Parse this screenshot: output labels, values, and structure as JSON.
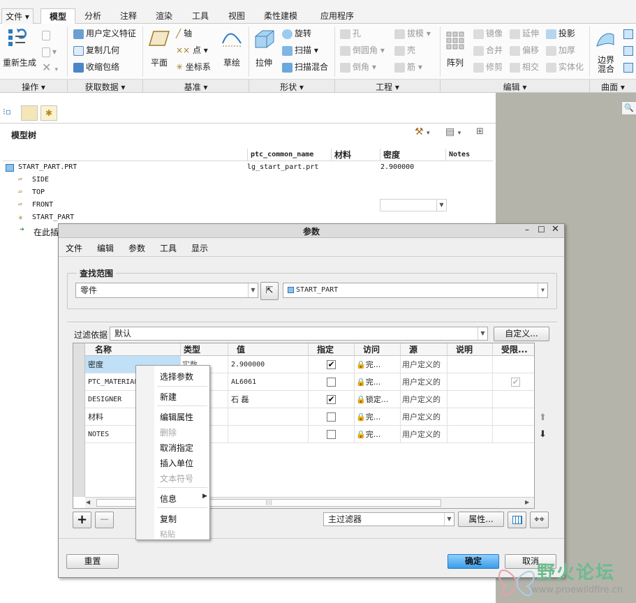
{
  "ribbon_tabs": [
    "文件",
    "模型",
    "分析",
    "注释",
    "渲染",
    "工具",
    "视图",
    "柔性建模",
    "应用程序"
  ],
  "active_tab": "模型",
  "ribbon": {
    "operations": {
      "regenerate": "重新生成"
    },
    "get_data": {
      "user_feature": "用户定义特征",
      "copy_geometry": "复制几何",
      "shrinkwrap": "收缩包络"
    },
    "datum": {
      "plane": "平面",
      "axis": "轴",
      "point": "点",
      "csys": "坐标系",
      "sketch": "草绘"
    },
    "shapes": {
      "extrude": "拉伸",
      "revolve": "旋转",
      "sweep": "扫描",
      "swept_blend": "扫描混合"
    },
    "engineering": {
      "hole": "孔",
      "round": "倒圆角",
      "chamfer": "倒角",
      "draft": "拔模",
      "shell": "壳",
      "rib": "筋"
    },
    "editing": {
      "pattern": "阵列",
      "mirror": "镜像",
      "merge": "合并",
      "trim": "修剪",
      "extend": "延伸",
      "offset": "偏移",
      "intersect": "相交",
      "project": "投影",
      "thicken": "加厚",
      "solidify": "实体化"
    },
    "surfaces": {
      "boundary_blend": "边界混合"
    },
    "group_labels": [
      "操作",
      "获取数据",
      "基准",
      "形状",
      "工程",
      "编辑",
      "曲面"
    ]
  },
  "model_tree": {
    "title": "模型树",
    "columns": [
      "ptc_common_name",
      "材料",
      "密度",
      "Notes"
    ],
    "root": {
      "name": "START_PART.PRT",
      "ptc_common_name": "lg_start_part.prt",
      "density": "2.900000"
    },
    "items": [
      "SIDE",
      "TOP",
      "FRONT",
      "START_PART",
      "在此插"
    ]
  },
  "dialog": {
    "title": "参数",
    "menu": [
      "文件",
      "编辑",
      "参数",
      "工具",
      "显示"
    ],
    "lookin_label": "查找范围",
    "lookin_type": "零件",
    "lookin_object": "START_PART",
    "filter_label": "过滤依据",
    "filter_value": "默认",
    "customize_button": "自定义...",
    "table_headers": [
      "名称",
      "类型",
      "值",
      "指定",
      "访问",
      "源",
      "说明",
      "受限..."
    ],
    "rows": [
      {
        "name": "密度",
        "type": "实数",
        "value": "2.900000",
        "designated": true,
        "access": "完...",
        "source": "用户定义的",
        "restricted": false
      },
      {
        "name": "PTC_MATERIAL",
        "type": "",
        "value": "AL6061",
        "designated": false,
        "access": "完...",
        "source": "用户定义的",
        "restricted": true
      },
      {
        "name": "DESIGNER",
        "type": "",
        "value": "石  磊",
        "designated": true,
        "access": "锁定...",
        "source": "用户定义的",
        "restricted": false
      },
      {
        "name": "材料",
        "type": "",
        "value": "",
        "designated": false,
        "access": "完...",
        "source": "用户定义的",
        "restricted": false
      },
      {
        "name": "NOTES",
        "type": "",
        "value": "",
        "designated": false,
        "access": "完...",
        "source": "用户定义的",
        "restricted": false
      }
    ],
    "main_filter": "主过滤器",
    "properties_button": "属性...",
    "reset_button": "重置",
    "ok_button": "确定",
    "cancel_button": "取消"
  },
  "context_menu": {
    "items": [
      {
        "label": "选择参数",
        "enabled": true
      },
      {
        "label": "新建",
        "enabled": true
      },
      {
        "label": "编辑属性",
        "enabled": true
      },
      {
        "label": "删除",
        "enabled": false
      },
      {
        "label": "取消指定",
        "enabled": true
      },
      {
        "label": "插入单位",
        "enabled": true
      },
      {
        "label": "文本符号",
        "enabled": false
      },
      {
        "label": "信息",
        "enabled": true
      },
      {
        "label": "复制",
        "enabled": true
      },
      {
        "label": "粘贴",
        "enabled": false
      }
    ]
  },
  "watermark": {
    "title": "野火论坛",
    "url": "www.proewildfire.cn"
  },
  "colors": {
    "accent": "#d8ecfb",
    "selection": "#bfe0f7",
    "ok_button": "#57aef0",
    "watermark": "#78c0a0"
  }
}
